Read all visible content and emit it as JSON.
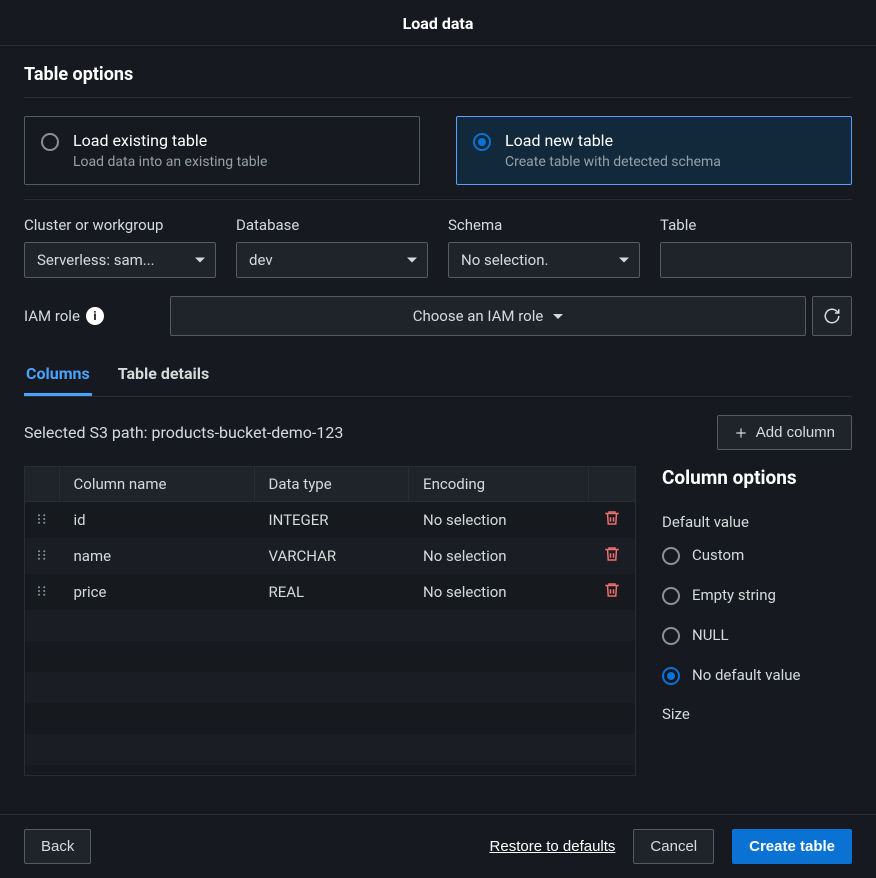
{
  "dialog_title": "Load data",
  "section_title": "Table options",
  "tiles": {
    "existing": {
      "title": "Load existing table",
      "desc": "Load data into an existing table"
    },
    "new": {
      "title": "Load new table",
      "desc": "Create table with detected schema"
    }
  },
  "labels": {
    "cluster": "Cluster or workgroup",
    "database": "Database",
    "schema": "Schema",
    "table": "Table",
    "iam_role": "IAM role"
  },
  "values": {
    "cluster": "Serverless: sam...",
    "database": "dev",
    "schema": "No selection.",
    "table": "",
    "iam_role": "Choose an IAM role"
  },
  "tabs": {
    "columns": "Columns",
    "details": "Table details"
  },
  "s3_path_label": "Selected S3 path: ",
  "s3_path_value": "products-bucket-demo-123",
  "add_column": "Add column",
  "table_headers": {
    "name": "Column name",
    "type": "Data type",
    "encoding": "Encoding"
  },
  "rows": [
    {
      "name": "id",
      "type": "INTEGER",
      "encoding": "No selection"
    },
    {
      "name": "name",
      "type": "VARCHAR",
      "encoding": "No selection"
    },
    {
      "name": "price",
      "type": "REAL",
      "encoding": "No selection"
    }
  ],
  "column_options": {
    "title": "Column options",
    "default_value_label": "Default value",
    "radios": {
      "custom": "Custom",
      "empty": "Empty string",
      "null": "NULL",
      "none": "No default value"
    },
    "size_label": "Size"
  },
  "footer": {
    "back": "Back",
    "restore": "Restore to defaults",
    "cancel": "Cancel",
    "create": "Create table"
  }
}
